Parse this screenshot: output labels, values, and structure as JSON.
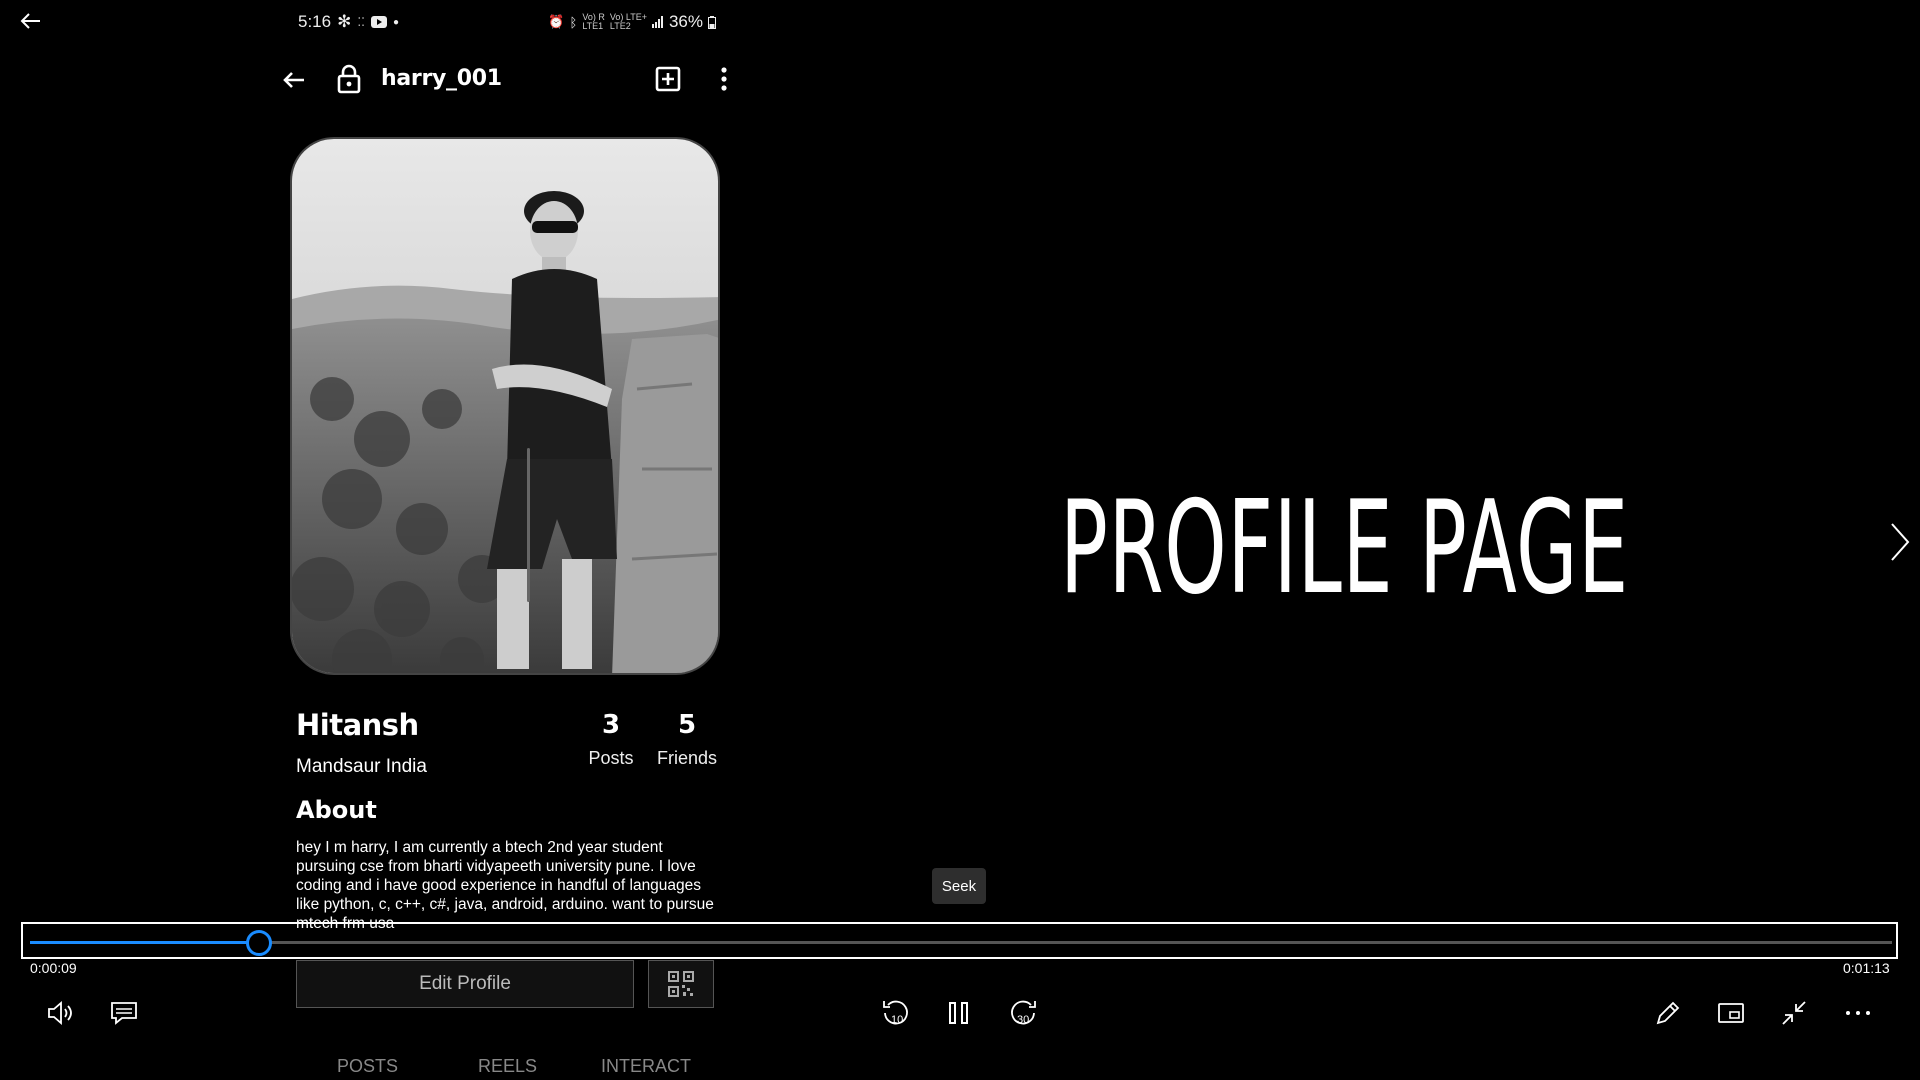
{
  "status_bar": {
    "time": "5:16",
    "signal_1": "Vo) R\nLTE1",
    "signal_2": "Vo) LTE+\nLTE2",
    "battery": "36%"
  },
  "app": {
    "username": "harry_001",
    "profile": {
      "name": "Hitansh",
      "location": "Mandsaur India",
      "posts_count": "3",
      "posts_label": "Posts",
      "friends_count": "5",
      "friends_label": "Friends"
    },
    "about_title": "About",
    "about_text": "hey I m harry, I am currently a btech 2nd year student pursuing cse from bharti vidyapeeth university pune. I love coding and i have good experience in handful of languages like python, c, c++, c#, java, android, arduino. want to pursue mtech frm usa",
    "edit_profile_label": "Edit Profile",
    "tabs": [
      "POSTS",
      "REELS",
      "INTERACT"
    ]
  },
  "slide": {
    "title": "PROFILE PAGE"
  },
  "player": {
    "tooltip": "Seek",
    "current_time": "0:00:09",
    "total_time": "0:01:13",
    "progress_fraction": 0.123,
    "accent_color": "#1a8cff",
    "controls": [
      "volume-icon",
      "captions-icon",
      "rewind-10-icon",
      "pause-icon",
      "forward-30-icon",
      "pen-icon",
      "mini-view-icon",
      "exit-fullscreen-icon",
      "more-icon"
    ],
    "rewind_label": "10",
    "forward_label": "30"
  }
}
